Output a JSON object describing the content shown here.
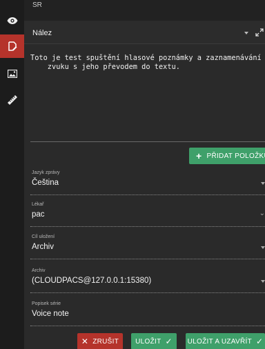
{
  "toolbar": {
    "items": [
      {
        "icon": "eye-icon",
        "active": false
      },
      {
        "icon": "edit-note-icon",
        "active": true
      },
      {
        "icon": "image-icon",
        "active": false
      },
      {
        "icon": "ruler-icon",
        "active": false
      }
    ]
  },
  "header": {
    "title": "SR"
  },
  "section": {
    "label": "Nález"
  },
  "editor": {
    "text": "Toto je test spuštění hlasové poznámky a zaznamenávání\n    zvuku s jeho převodem do textu."
  },
  "add_item": {
    "label": "PŘIDAT POLOŽKU"
  },
  "fields": {
    "language": {
      "label": "Jazyk zprávy",
      "value": "Čeština"
    },
    "doctor": {
      "label": "Lékař",
      "value": "pac"
    },
    "target": {
      "label": "Cíl uložení",
      "value": "Archiv"
    },
    "archive": {
      "label": "Archiv",
      "value": "(CLOUDPACS@127.0.0.1:15380)"
    },
    "series": {
      "label": "Popisek série",
      "value": "Voice note"
    }
  },
  "buttons": {
    "cancel": "ZRUŠIT",
    "save": "ULOŽIT",
    "save_close": "ULOŽIT A UZAVŘÍT"
  },
  "colors": {
    "accent_red": "#b5332b",
    "accent_green": "#3fa06a"
  }
}
